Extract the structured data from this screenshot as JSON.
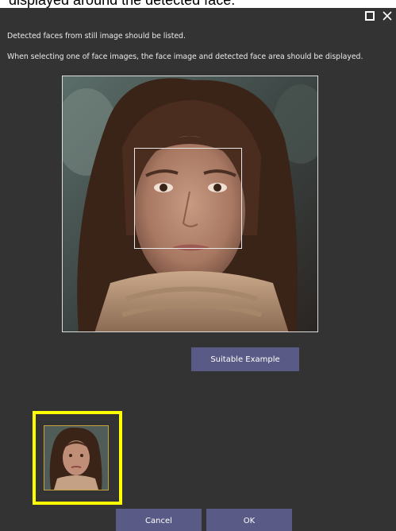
{
  "caption": {
    "text": "displayed around the detected face."
  },
  "window": {
    "maximize_icon": "maximize-icon",
    "close_icon": "close-icon"
  },
  "instructions": {
    "line1": "Detected faces from still image should be listed.",
    "line2": "When selecting one of face images, the face image and detected face area should be displayed."
  },
  "buttons": {
    "example_label": "Suitable Example",
    "cancel_label": "Cancel",
    "ok_label": "OK"
  },
  "colors": {
    "dialog_background": "#333333",
    "button_background": "#5a5a86",
    "selection_highlight": "#ffff00",
    "face_box_outline": "#e8e8e8"
  }
}
